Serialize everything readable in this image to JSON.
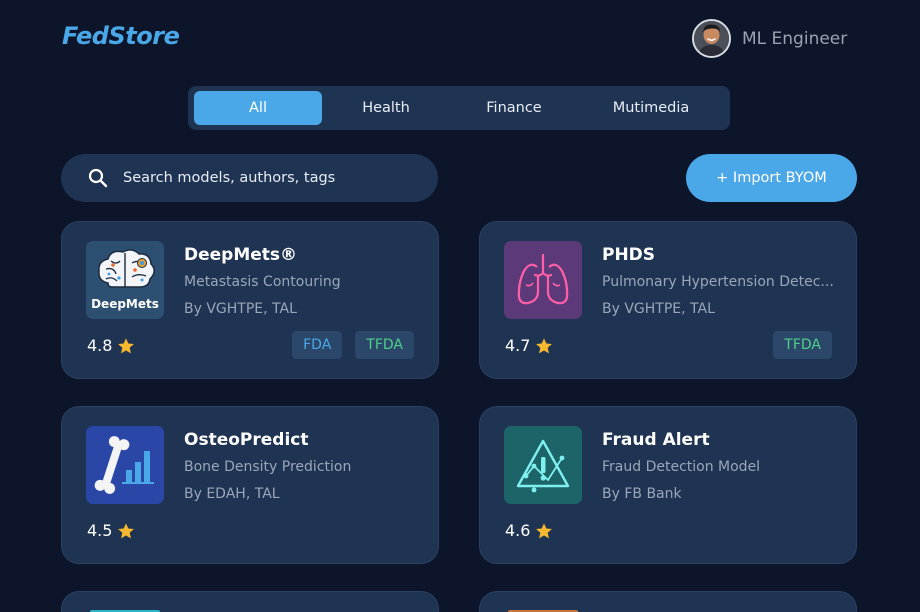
{
  "header": {
    "logo": "FedStore",
    "user_name": "ML Engineer"
  },
  "tabs": [
    {
      "label": "All",
      "active": true
    },
    {
      "label": "Health",
      "active": false
    },
    {
      "label": "Finance",
      "active": false
    },
    {
      "label": "Mutimedia",
      "active": false
    }
  ],
  "search": {
    "placeholder": "Search models, authors, tags"
  },
  "import_button": {
    "label": "+ Import BYOM"
  },
  "cards": [
    {
      "title": "DeepMets®",
      "subtitle": "Metastasis Contouring",
      "author": "By VGHTPE, TAL",
      "rating": "4.8",
      "icon": "brain-icon",
      "icon_text": "DeepMets",
      "badges": [
        "FDA",
        "TFDA"
      ]
    },
    {
      "title": "PHDS",
      "subtitle": "Pulmonary Hypertension Detec...",
      "author": "By VGHTPE, TAL",
      "rating": "4.7",
      "icon": "lungs-icon",
      "badges": [
        "TFDA"
      ]
    },
    {
      "title": "OsteoPredict",
      "subtitle": "Bone Density Prediction",
      "author": "By EDAH, TAL",
      "rating": "4.5",
      "icon": "bone-chart-icon",
      "badges": []
    },
    {
      "title": "Fraud Alert",
      "subtitle": "Fraud Detection Model",
      "author": "By FB Bank",
      "rating": "4.6",
      "icon": "fraud-warning-icon",
      "badges": []
    }
  ],
  "colors": {
    "background": "#0c1529",
    "card": "#1f3352",
    "accent": "#4aa8e8",
    "tfda_green": "#4fd08a",
    "star": "#f5b82e"
  }
}
